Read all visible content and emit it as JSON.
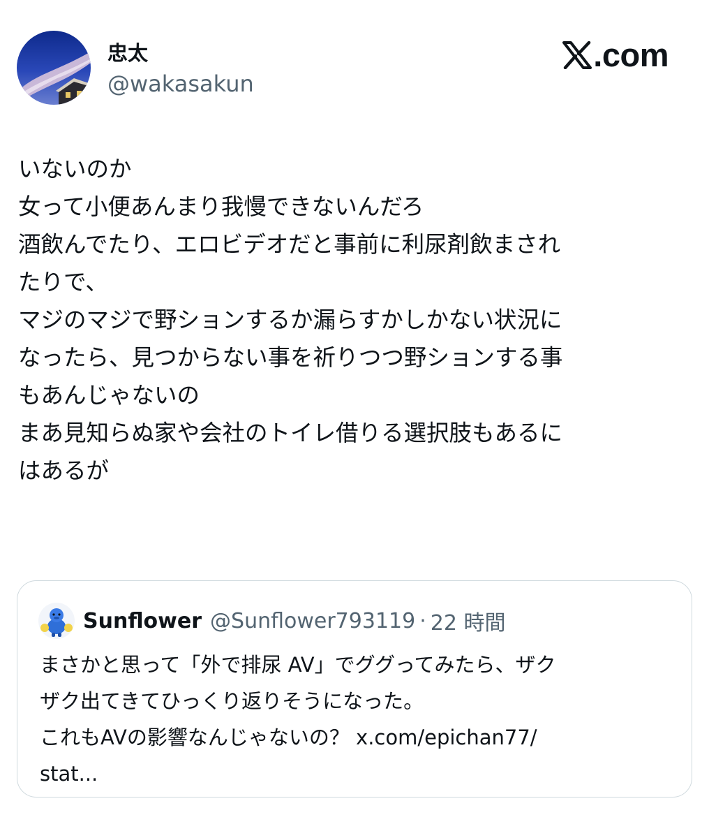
{
  "author": {
    "display_name": "忠太",
    "handle": "@wakasakun",
    "avatar_icon": "avatar-sky-photo"
  },
  "brand": {
    "logo_icon": "x-logo-icon",
    "text": ".com"
  },
  "tweet": {
    "lines": [
      "いないのか",
      "女って小便あんまり我慢できないんだろ",
      "酒飲んでたり、エロビデオだと事前に利尿剤飲まされ",
      "たりで、",
      "マジのマジで野ションするか漏らすかしかない状況に",
      "なったら、見つからない事を祈りつつ野ションする事",
      "もあんじゃないの",
      "まあ見知らぬ家や会社のトイレ借りる選択肢もあるに",
      "はあるが"
    ]
  },
  "quote": {
    "display_name": "Sunflower",
    "handle": "@Sunflower793119",
    "separator": "·",
    "time": "22 時間",
    "avatar_icon": "avatar-blue-character",
    "lines": [
      "まさかと思って「外で排尿 AV」でググってみたら、ザク",
      "ザク出てきてひっくり返りそうになった。",
      "これもAVの影響なんじゃないの？ x.com/epichan77/",
      "stat..."
    ]
  },
  "colors": {
    "text_primary": "#0f1419",
    "text_secondary": "#536471",
    "border": "#cfd9de",
    "background": "#ffffff"
  }
}
